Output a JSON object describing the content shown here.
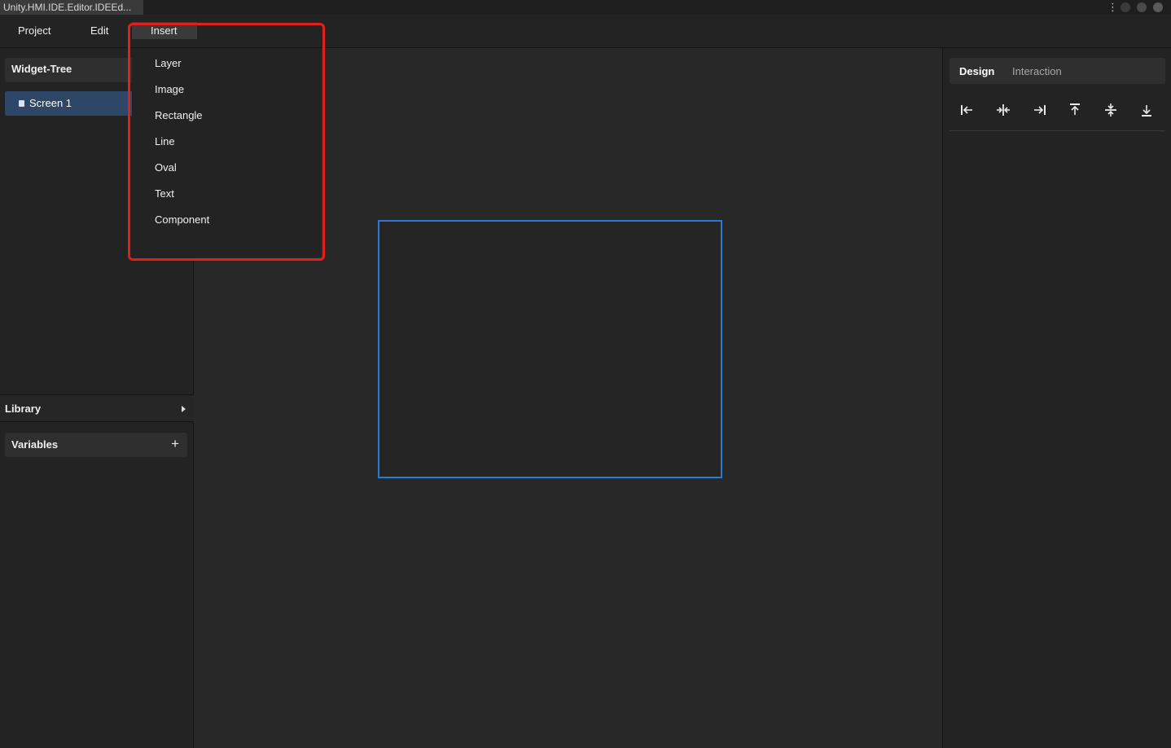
{
  "window": {
    "title": "Unity.HMI.IDE.Editor.IDEEd...",
    "menu_icon": "⋮"
  },
  "menubar": {
    "project": "Project",
    "edit": "Edit",
    "insert": "Insert"
  },
  "insert_menu": {
    "items": [
      "Layer",
      "Image",
      "Rectangle",
      "Line",
      "Oval",
      "Text",
      "Component"
    ]
  },
  "left_panel": {
    "widget_tree_title": "Widget-Tree",
    "tree_items": [
      "Screen 1"
    ],
    "library_label": "Library",
    "variables_label": "Variables",
    "variables_add": "+"
  },
  "right_panel": {
    "tabs": [
      "Design",
      "Interaction"
    ],
    "active_tab": "Design",
    "align_tools": [
      "align-left-icon",
      "align-horizontal-center-icon",
      "align-right-icon",
      "align-top-icon",
      "align-vertical-center-icon",
      "align-bottom-icon"
    ]
  },
  "colors": {
    "selection_blue": "#2a7bd4",
    "highlight_red": "#e0201c",
    "tree_selected": "#2e4766"
  }
}
